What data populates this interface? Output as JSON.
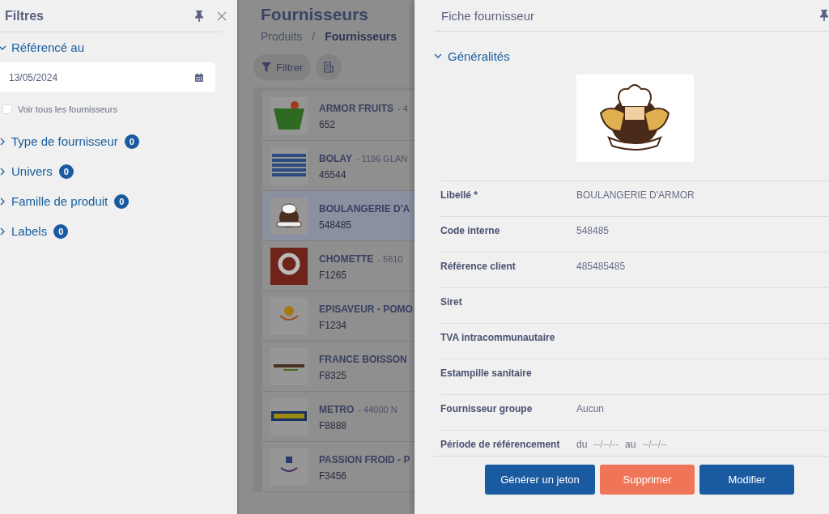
{
  "filters": {
    "title": "Filtres",
    "sections": [
      {
        "label": "Référencé au",
        "expanded": true,
        "date": "13/05/2024",
        "checkbox": {
          "label": "Voir tous les fournisseurs",
          "checked": false
        }
      },
      {
        "label": "Type de fournisseur",
        "expanded": false,
        "count": "0"
      },
      {
        "label": "Univers",
        "expanded": false,
        "count": "0"
      },
      {
        "label": "Famille de produit",
        "expanded": false,
        "count": "0"
      },
      {
        "label": "Labels",
        "expanded": false,
        "count": "0"
      }
    ]
  },
  "page": {
    "title": "Fournisseurs",
    "breadcrumb": [
      "Produits",
      "Fournisseurs"
    ],
    "breadcrumb_separator": "/",
    "filter_button": "Filtrer",
    "suppliers": [
      {
        "name": "ARMOR FRUITS",
        "location": "- 4",
        "code": "652",
        "kind": "armor",
        "selected": false
      },
      {
        "name": "BOLAY",
        "location": "- 1196 GLAN",
        "code": "45544",
        "kind": "bolay",
        "selected": false
      },
      {
        "name": "BOULANGERIE D'A",
        "code": "548485",
        "kind": "bakery",
        "selected": true
      },
      {
        "name": "CHOMETTE",
        "location": "- 5610",
        "code": "F1265",
        "kind": "chomette",
        "selected": false
      },
      {
        "name": "EPISAVEUR - POMO",
        "code": "F1234",
        "kind": "episaveur",
        "selected": false
      },
      {
        "name": "FRANCE BOISSON",
        "code": "F8325",
        "kind": "france",
        "selected": false
      },
      {
        "name": "METRO",
        "location": "- 44000 N",
        "code": "F8888",
        "kind": "metro",
        "selected": false
      },
      {
        "name": "PASSION FROID - P",
        "code": "F3456",
        "kind": "passion",
        "selected": false
      }
    ]
  },
  "detail": {
    "title": "Fiche fournisseur",
    "section": {
      "label": "Généralités",
      "expanded": true
    },
    "fields": [
      {
        "label": "Libellé *",
        "value": "BOULANGERIE D'ARMOR"
      },
      {
        "label": "Code interne",
        "value": "548485"
      },
      {
        "label": "Référence client",
        "value": "485485485"
      },
      {
        "label": "Siret"
      },
      {
        "label": "TVA intracommunautaire"
      },
      {
        "label": "Estampille sanitaire"
      },
      {
        "label": "Fournisseur groupe",
        "value": "Aucun"
      }
    ],
    "period": {
      "label": "Période de référencement",
      "from_label": "du",
      "from": "--/--/--",
      "to_label": "au",
      "to": "--/--/--"
    },
    "buttons": [
      {
        "label": "Générer un jeton",
        "kind": "primary"
      },
      {
        "label": "Supprimer",
        "kind": "danger"
      },
      {
        "label": "Modifier",
        "kind": "primary"
      }
    ]
  }
}
